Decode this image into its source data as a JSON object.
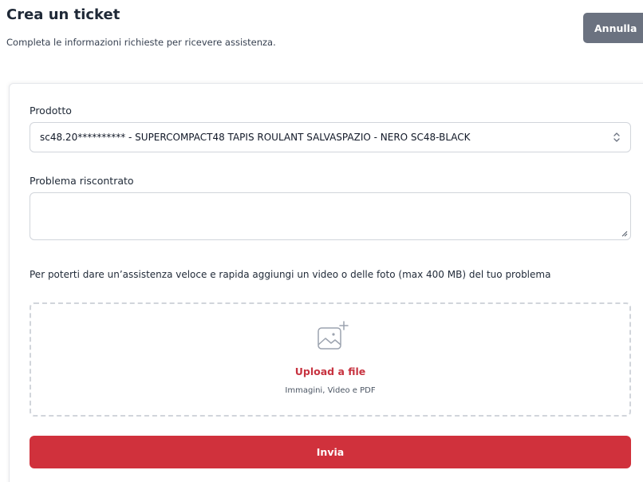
{
  "header": {
    "title": "Crea un ticket",
    "subtitle": "Completa le informazioni richieste per ricevere assistenza.",
    "cancel_label": "Annulla"
  },
  "form": {
    "product": {
      "label": "Prodotto",
      "selected_value": "sc48.20********** - SUPERCOMPACT48 TAPIS ROULANT SALVASPAZIO - NERO SC48-BLACK",
      "icon": "chevron-up-down-icon"
    },
    "problem": {
      "label": "Problema riscontrato",
      "value": ""
    },
    "upload": {
      "instructions": "Per poterti dare un’assistenza veloce e rapida aggiungi un video o delle foto (max 400 MB) del tuo problema",
      "icon": "image-add-icon",
      "link_label": "Upload a file",
      "hint": "Immagini, Video e PDF"
    },
    "submit_label": "Invia"
  },
  "colors": {
    "accent": "#d0313c",
    "upload_link": "#c73340",
    "cancel_bg": "#6b7280",
    "border": "#d1d5db"
  }
}
